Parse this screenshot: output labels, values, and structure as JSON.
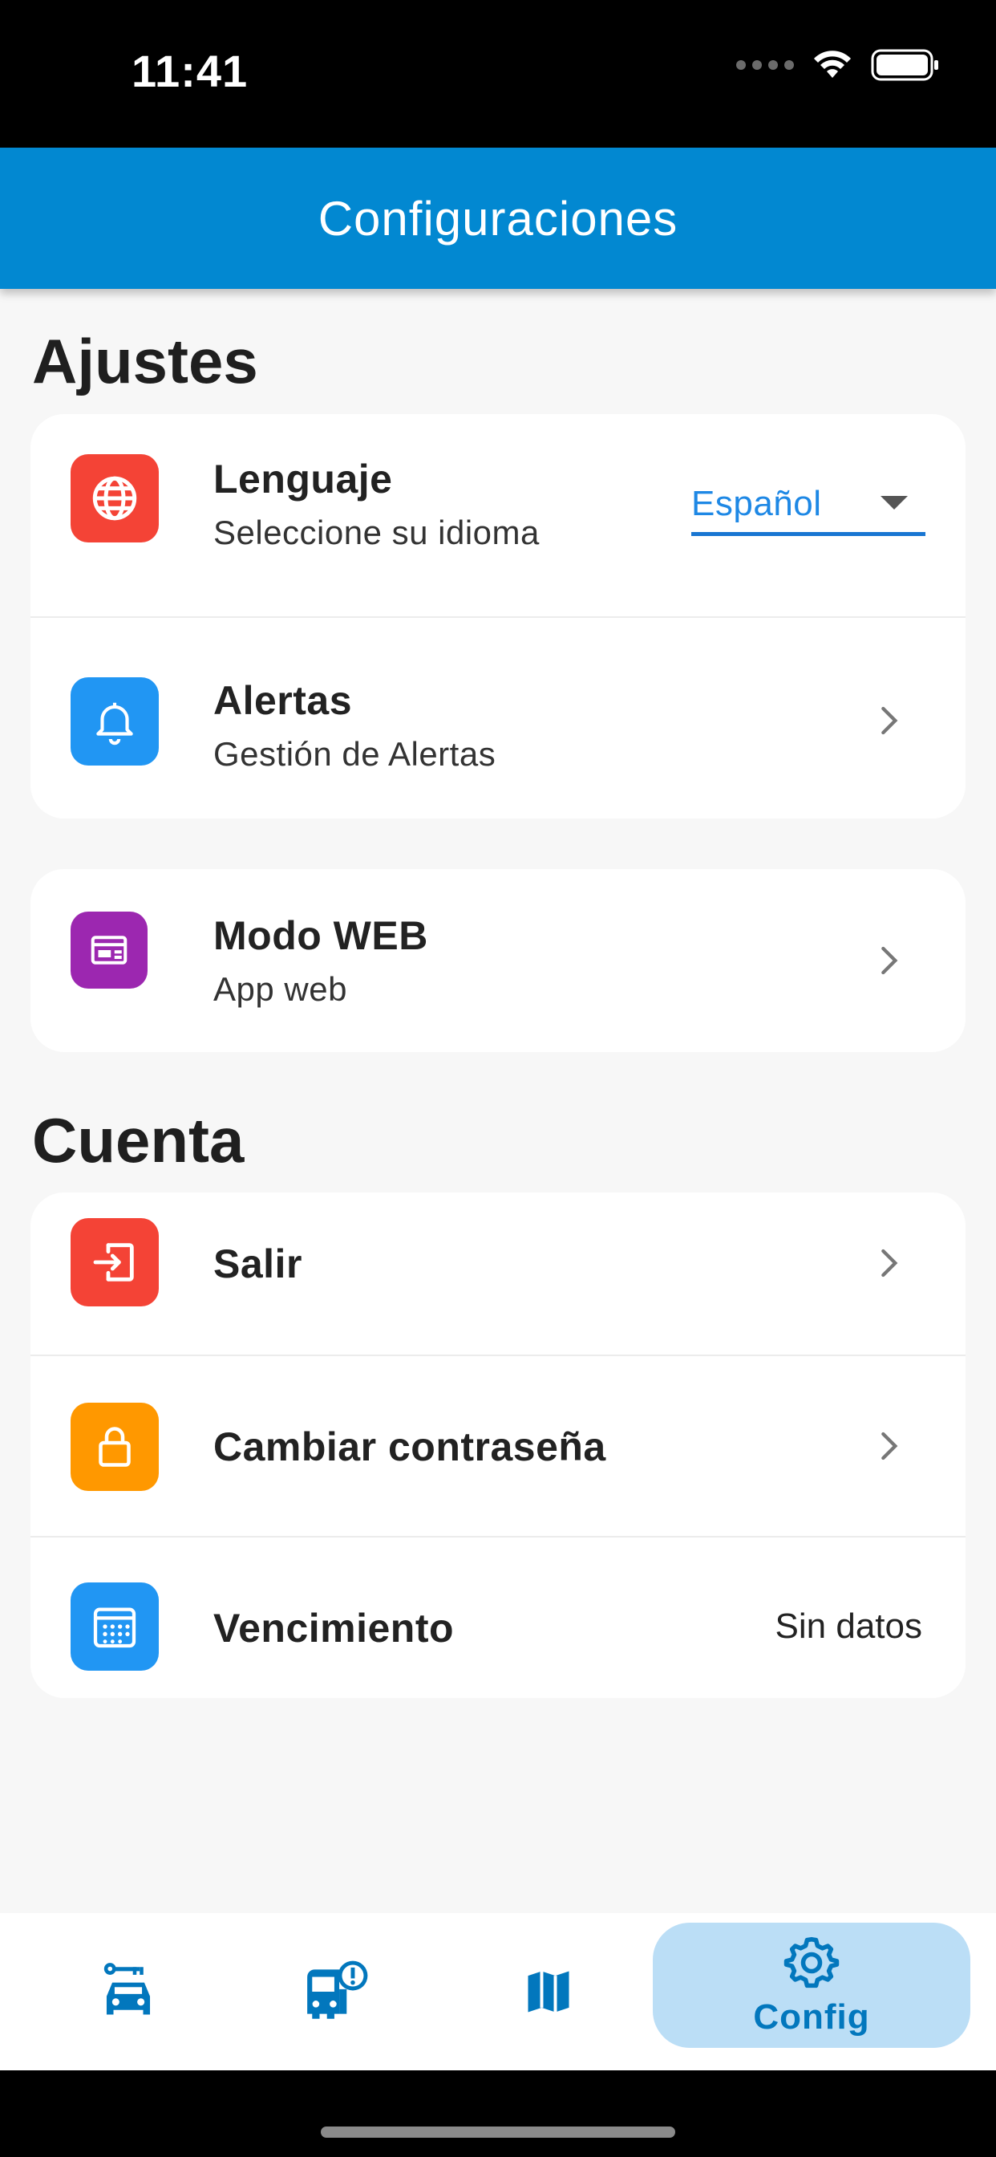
{
  "status_bar": {
    "time": "11:41"
  },
  "app_bar": {
    "title": "Configuraciones"
  },
  "sections": {
    "ajustes": "Ajustes",
    "cuenta": "Cuenta"
  },
  "ajustes_card": {
    "language": {
      "title": "Lenguaje",
      "subtitle": "Seleccione su idioma",
      "selected": "Español"
    },
    "alerts": {
      "title": "Alertas",
      "subtitle": "Gestión de Alertas"
    }
  },
  "web_card": {
    "title": "Modo WEB",
    "subtitle": "App web"
  },
  "cuenta_card": {
    "logout": {
      "title": "Salir"
    },
    "password": {
      "title": "Cambiar contraseña"
    },
    "expiry": {
      "title": "Vencimiento",
      "value": "Sin datos"
    }
  },
  "bottom_nav": {
    "active_label": "Config",
    "items": [
      "vehicle-key-icon",
      "bus-alert-icon",
      "map-icon",
      "gear-icon"
    ]
  },
  "colors": {
    "primary": "#0288d1",
    "red_icon": "#f44336",
    "blue_icon": "#2196f3",
    "purple_icon": "#9c27b0",
    "orange_icon": "#ff9800",
    "nav_active_bg": "#bbdef6"
  }
}
